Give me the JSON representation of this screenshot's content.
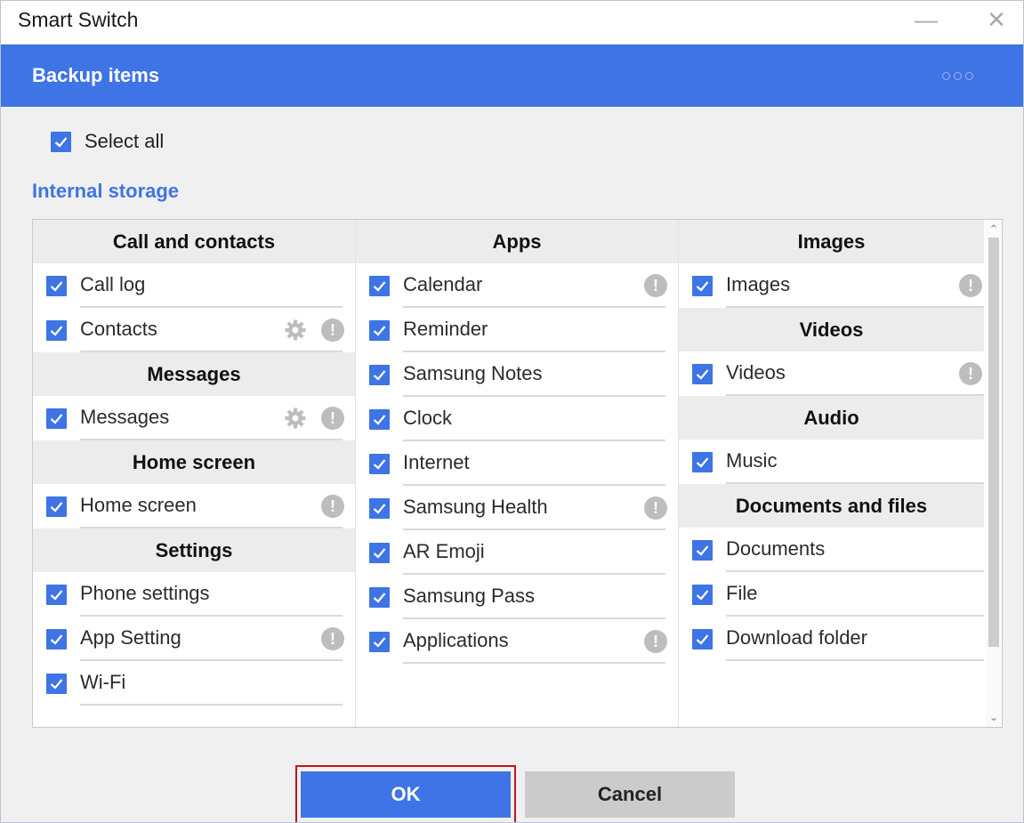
{
  "window": {
    "title": "Smart Switch",
    "minimize": "—",
    "close": "✕"
  },
  "banner": {
    "title": "Backup items",
    "menu_icon": "more-dots-icon"
  },
  "select_all": {
    "label": "Select all",
    "checked": true
  },
  "storage": {
    "label": "Internal storage"
  },
  "columns": [
    {
      "sections": [
        {
          "header": "Call and contacts",
          "items": [
            {
              "label": "Call log",
              "checked": true,
              "gear": false,
              "info": false
            },
            {
              "label": "Contacts",
              "checked": true,
              "gear": true,
              "info": true
            }
          ]
        },
        {
          "header": "Messages",
          "items": [
            {
              "label": "Messages",
              "checked": true,
              "gear": true,
              "info": true
            }
          ]
        },
        {
          "header": "Home screen",
          "items": [
            {
              "label": "Home screen",
              "checked": true,
              "gear": false,
              "info": true
            }
          ]
        },
        {
          "header": "Settings",
          "items": [
            {
              "label": "Phone settings",
              "checked": true,
              "gear": false,
              "info": false
            },
            {
              "label": "App Setting",
              "checked": true,
              "gear": false,
              "info": true
            },
            {
              "label": "Wi-Fi",
              "checked": true,
              "gear": false,
              "info": false
            }
          ]
        }
      ]
    },
    {
      "sections": [
        {
          "header": "Apps",
          "items": [
            {
              "label": "Calendar",
              "checked": true,
              "gear": false,
              "info": true
            },
            {
              "label": "Reminder",
              "checked": true,
              "gear": false,
              "info": false
            },
            {
              "label": "Samsung Notes",
              "checked": true,
              "gear": false,
              "info": false
            },
            {
              "label": "Clock",
              "checked": true,
              "gear": false,
              "info": false
            },
            {
              "label": "Internet",
              "checked": true,
              "gear": false,
              "info": false
            },
            {
              "label": "Samsung Health",
              "checked": true,
              "gear": false,
              "info": true
            },
            {
              "label": "AR Emoji",
              "checked": true,
              "gear": false,
              "info": false
            },
            {
              "label": "Samsung Pass",
              "checked": true,
              "gear": false,
              "info": false
            },
            {
              "label": "Applications",
              "checked": true,
              "gear": false,
              "info": true
            }
          ]
        }
      ]
    },
    {
      "sections": [
        {
          "header": "Images",
          "items": [
            {
              "label": "Images",
              "checked": true,
              "gear": false,
              "info": true
            }
          ]
        },
        {
          "header": "Videos",
          "items": [
            {
              "label": "Videos",
              "checked": true,
              "gear": false,
              "info": true
            }
          ]
        },
        {
          "header": "Audio",
          "items": [
            {
              "label": "Music",
              "checked": true,
              "gear": false,
              "info": false
            }
          ]
        },
        {
          "header": "Documents and files",
          "items": [
            {
              "label": "Documents",
              "checked": true,
              "gear": false,
              "info": false
            },
            {
              "label": "File",
              "checked": true,
              "gear": false,
              "info": false
            },
            {
              "label": "Download folder",
              "checked": true,
              "gear": false,
              "info": false
            }
          ]
        }
      ]
    }
  ],
  "buttons": {
    "ok": "OK",
    "cancel": "Cancel"
  },
  "colors": {
    "accent": "#3e74e5",
    "highlight_outline": "#c0141c"
  }
}
